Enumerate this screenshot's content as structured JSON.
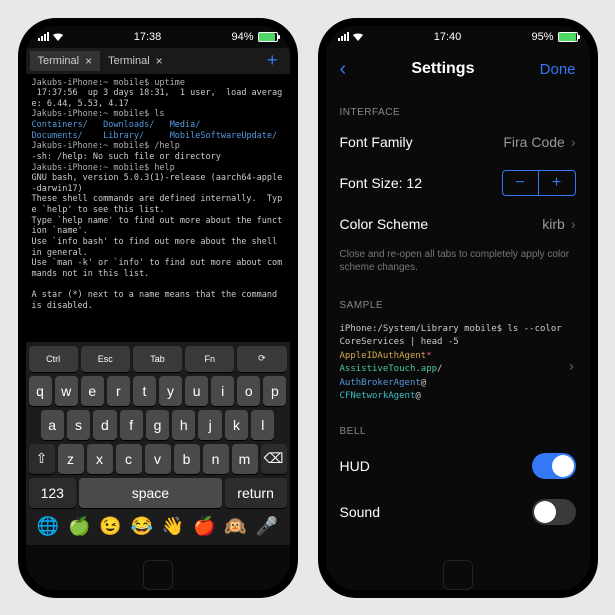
{
  "left": {
    "status": {
      "time": "17:38",
      "battery_pct": "94%",
      "battery_fill": "94%"
    },
    "tabs": [
      {
        "label": "Terminal",
        "active": true
      },
      {
        "label": "Terminal",
        "active": false
      }
    ],
    "terminal_lines": [
      {
        "text": "Jakubs-iPhone:~ mobile$ uptime",
        "class": "t-host"
      },
      {
        "text": " 17:37:56  up 3 days 18:31,  1 user,  load average: 6.44, 5.53, 4.17"
      },
      {
        "text": "Jakubs-iPhone:~ mobile$ ls",
        "class": "t-host"
      },
      {
        "parts": [
          {
            "text": "Containers/   ",
            "class": "t-blue"
          },
          {
            "text": "Downloads/   ",
            "class": "t-blue"
          },
          {
            "text": "Media/",
            "class": "t-blue"
          }
        ]
      },
      {
        "parts": [
          {
            "text": "Documents/    ",
            "class": "t-blue"
          },
          {
            "text": "Library/     ",
            "class": "t-blue"
          },
          {
            "text": "MobileSoftwareUpdate/",
            "class": "t-blue"
          }
        ]
      },
      {
        "text": "Jakubs-iPhone:~ mobile$ /help",
        "class": "t-host"
      },
      {
        "text": "-sh: /help: No such file or directory"
      },
      {
        "text": "Jakubs-iPhone:~ mobile$ help",
        "class": "t-host"
      },
      {
        "text": "GNU bash, version 5.0.3(1)-release (aarch64-apple-darwin17)"
      },
      {
        "text": "These shell commands are defined internally.  Type `help' to see this list."
      },
      {
        "text": "Type `help name' to find out more about the function `name'."
      },
      {
        "text": "Use `info bash' to find out more about the shell in general."
      },
      {
        "text": "Use `man -k' or `info' to find out more about commands not in this list."
      },
      {
        "text": " "
      },
      {
        "text": "A star (*) next to a name means that the command is disabled."
      }
    ],
    "fn_keys": [
      "Ctrl",
      "Esc",
      "Tab",
      "Fn",
      "⟳"
    ],
    "kb_rows": [
      [
        "q",
        "w",
        "e",
        "r",
        "t",
        "y",
        "u",
        "i",
        "o",
        "p"
      ],
      [
        "a",
        "s",
        "d",
        "f",
        "g",
        "h",
        "j",
        "k",
        "l"
      ],
      [
        "⇧",
        "z",
        "x",
        "c",
        "v",
        "b",
        "n",
        "m",
        "⌫"
      ]
    ],
    "bottom_row": {
      "num": "123",
      "space": "space",
      "return": "return"
    },
    "emojis": [
      "🌐",
      "🍏",
      "😉",
      "😂",
      "👋",
      "🍎",
      "🙉",
      "🎤"
    ]
  },
  "right": {
    "status": {
      "time": "17:40",
      "battery_pct": "95%",
      "battery_fill": "95%"
    },
    "header": {
      "title": "Settings",
      "done": "Done"
    },
    "sections": {
      "interface_label": "INTERFACE",
      "font_family": {
        "label": "Font Family",
        "value": "Fira Code"
      },
      "font_size": {
        "label": "Font Size: 12"
      },
      "color_scheme": {
        "label": "Color Scheme",
        "value": "kirb"
      },
      "hint": "Close and re-open all tabs to completely apply color scheme changes.",
      "sample_label": "SAMPLE",
      "sample_lines": [
        {
          "text": "iPhone:/System/Library mobile$ ls --color CoreServices | head -5",
          "class": "s-white"
        },
        {
          "parts": [
            {
              "text": "AppleIDAuthAgent",
              "class": "s-yellow"
            },
            {
              "text": "*",
              "class": "s-pink"
            }
          ]
        },
        {
          "parts": [
            {
              "text": "AssistiveTouch.app",
              "class": "s-green"
            },
            {
              "text": "/",
              "class": "s-white"
            }
          ]
        },
        {
          "parts": [
            {
              "text": "AuthBrokerAgent",
              "class": "s-blue"
            },
            {
              "text": "@",
              "class": "s-white"
            }
          ]
        },
        {
          "parts": [
            {
              "text": "CFNetworkAgent",
              "class": "s-cyan"
            },
            {
              "text": "@",
              "class": "s-white"
            }
          ]
        }
      ],
      "bell_label": "BELL",
      "hud": {
        "label": "HUD",
        "on": true
      },
      "sound": {
        "label": "Sound",
        "on": false
      }
    }
  }
}
